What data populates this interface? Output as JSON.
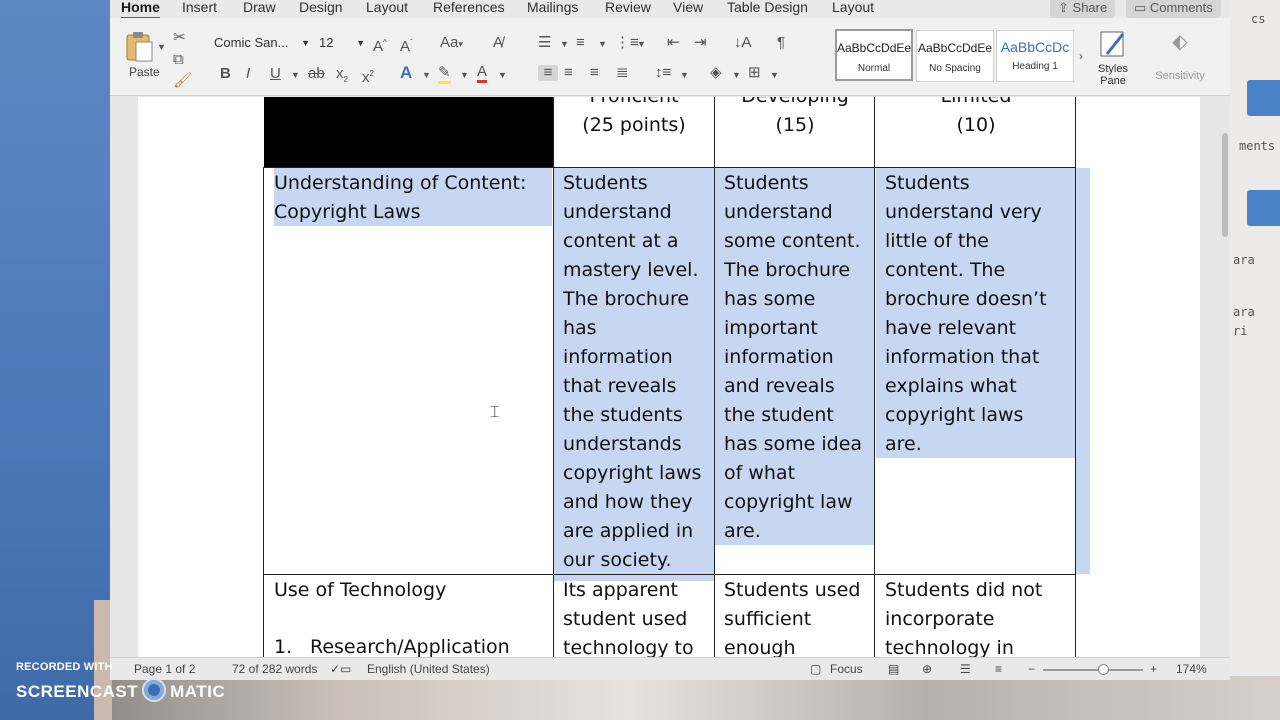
{
  "ribbon": {
    "tabs": [
      "Home",
      "Insert",
      "Draw",
      "Design",
      "Layout",
      "References",
      "Mailings",
      "Review",
      "View",
      "Table Design",
      "Layout"
    ],
    "active_tab": "Home",
    "share_label": "Share",
    "comments_label": "Comments",
    "paste_label": "Paste",
    "font_name": "Comic San...",
    "font_size": "12",
    "styles": [
      {
        "sample": "AaBbCcDdEe",
        "name": "Normal"
      },
      {
        "sample": "AaBbCcDdEe",
        "name": "No Spacing"
      },
      {
        "sample": "AaBbCcDc",
        "name": "Heading 1"
      }
    ],
    "styles_pane_label": "Styles Pane",
    "sensitivity_label": "Sensitivity",
    "colors": {
      "accent": "#2a64c8",
      "heading_sample": "#3d6fb6",
      "highlight": "#f5e642",
      "font_color": "#d23b2b"
    }
  },
  "table": {
    "header": {
      "proficient": [
        "Proficient",
        "(25 points)"
      ],
      "developing": [
        "Developing",
        "(15)"
      ],
      "limited": [
        "Limited",
        "(10)"
      ]
    },
    "row1": {
      "criterion": [
        "Understanding of Content:",
        "Copyright Laws"
      ],
      "proficient": [
        "Students",
        "understand",
        "content at a",
        "mastery level.",
        "The brochure",
        "has",
        "information",
        "that reveals",
        "the students",
        "understands",
        "copyright laws",
        "and how they",
        "are applied in",
        "our society."
      ],
      "developing": [
        "Students",
        "understand",
        "some content.",
        "The brochure",
        "has some",
        "important",
        "information",
        "and reveals",
        "the student",
        "has some idea",
        "of what",
        "copyright law",
        "are."
      ],
      "limited": [
        "Students",
        "understand very",
        "little of the",
        "content. The",
        "brochure doesn’t",
        "have relevant",
        "information that",
        "explains what",
        "copyright laws",
        "are."
      ]
    },
    "row2": {
      "criterion": "Use of Technology",
      "list_item_number": "1.",
      "list_item": "Research/Application",
      "proficient": [
        "Its apparent",
        "student used",
        "technology to"
      ],
      "developing": [
        "Students used",
        "sufficient",
        "enough"
      ],
      "limited": [
        "Students did not",
        "incorporate",
        "technology in"
      ]
    },
    "selection_color": "#c7d7f2"
  },
  "status": {
    "page": "Page 1 of 2",
    "words": "72 of 282 words",
    "language": "English (United States)",
    "focus_label": "Focus",
    "zoom": "174%",
    "zoom_level_fraction": 0.6
  },
  "watermark": {
    "recorded": "RECORDED WITH",
    "brand_left": "SCREENCAST",
    "brand_right": "MATIC"
  },
  "side_panel": {
    "fragments": [
      "cs",
      "ments",
      "ara",
      "ara",
      "ri"
    ]
  }
}
